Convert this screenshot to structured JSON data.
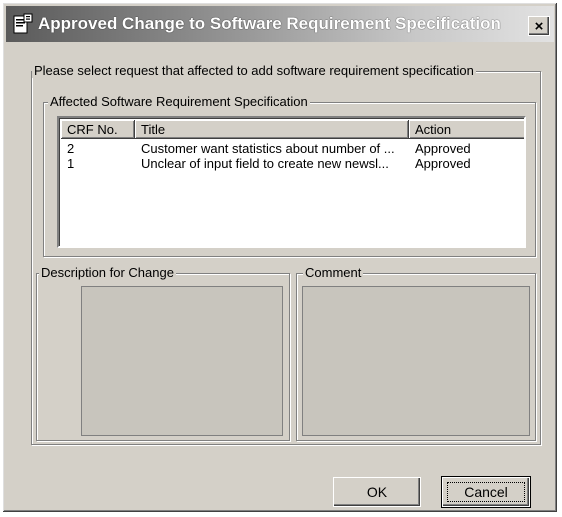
{
  "window": {
    "title": "Approved Change to Software Requirement Specification",
    "close_glyph": "×"
  },
  "main_group": {
    "legend": "Please select request that affected to add software requirement specification"
  },
  "affected_group": {
    "legend": "Affected Software Requirement Specification",
    "columns": [
      "CRF No.",
      "Title",
      "Action"
    ],
    "rows": [
      {
        "crf": "2",
        "title": "Customer want statistics about number of ...",
        "action": "Approved"
      },
      {
        "crf": "1",
        "title": "Unclear of input field to create new newsl...",
        "action": "Approved"
      }
    ]
  },
  "description_group": {
    "legend": "Description for Change",
    "value": ""
  },
  "comment_group": {
    "legend": "Comment",
    "value": ""
  },
  "buttons": {
    "ok": "OK",
    "cancel": "Cancel"
  },
  "icons": {
    "title": "document-app-icon",
    "close": "close-icon"
  }
}
